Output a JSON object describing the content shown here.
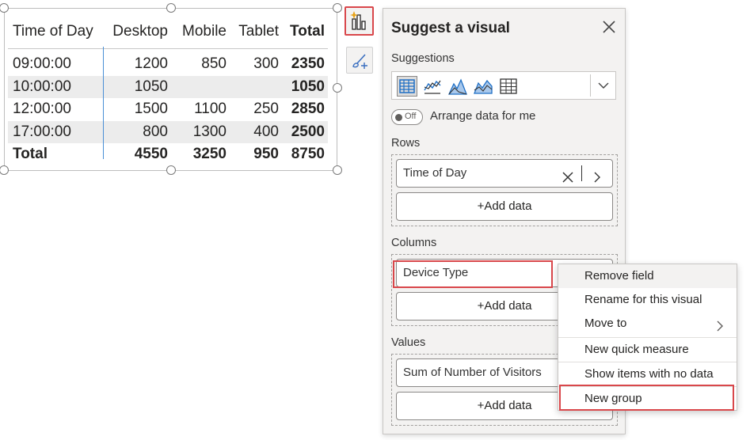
{
  "matrix": {
    "headers": [
      "Time of Day",
      "Desktop",
      "Mobile",
      "Tablet",
      "Total"
    ],
    "rows": [
      {
        "label": "09:00:00",
        "desktop": "1200",
        "mobile": "850",
        "tablet": "300",
        "total": "2350"
      },
      {
        "label": "10:00:00",
        "desktop": "1050",
        "mobile": "",
        "tablet": "",
        "total": "1050"
      },
      {
        "label": "12:00:00",
        "desktop": "1500",
        "mobile": "1100",
        "tablet": "250",
        "total": "2850"
      },
      {
        "label": "17:00:00",
        "desktop": "800",
        "mobile": "1300",
        "tablet": "400",
        "total": "2500"
      }
    ],
    "totals": {
      "label": "Total",
      "desktop": "4550",
      "mobile": "3250",
      "tablet": "950",
      "total": "8750"
    }
  },
  "panel": {
    "title": "Suggest a visual",
    "suggestions_label": "Suggestions",
    "toggle_state": "Off",
    "arrange_label": "Arrange data for me",
    "rows_label": "Rows",
    "rows_field": "Time of Day",
    "columns_label": "Columns",
    "columns_field": "Device Type",
    "values_label": "Values",
    "values_field": "Sum of Number of Visitors",
    "add_data": "+Add data"
  },
  "context_menu": {
    "items": [
      "Remove field",
      "Rename for this visual",
      "Move to",
      "New quick measure",
      "Show items with no data",
      "New group"
    ]
  },
  "colors": {
    "accent_blue": "#1f6fc5",
    "highlight_red": "#d9474b",
    "panel_bg": "#f3f2f1"
  }
}
